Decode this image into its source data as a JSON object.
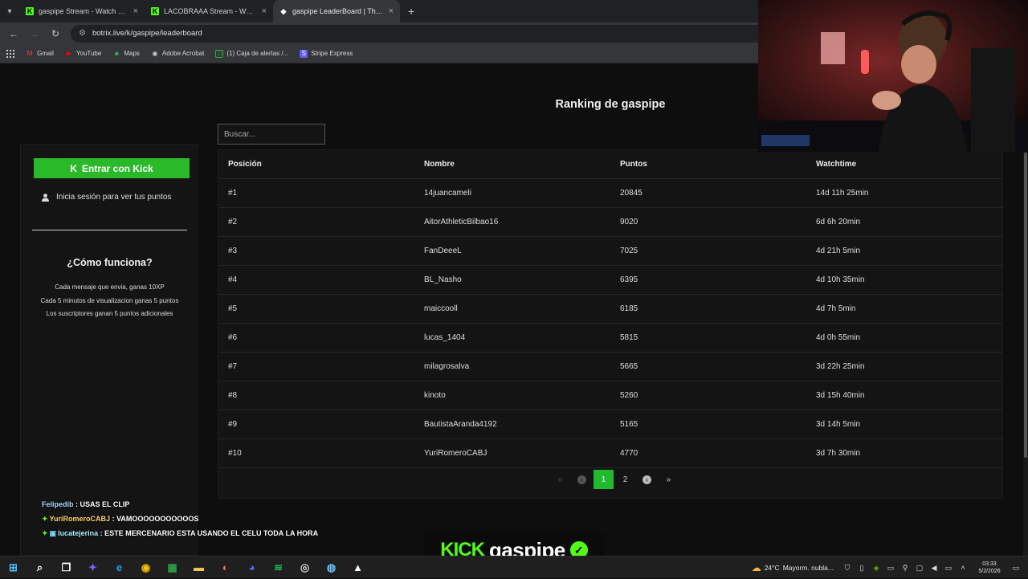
{
  "browser": {
    "tabs": [
      {
        "title": "gaspipe Stream - Watch Live on",
        "icon": "kick-icon"
      },
      {
        "title": "LACOBRAAA Stream - Watch Li",
        "icon": "kick-icon"
      },
      {
        "title": "gaspipe LeaderBoard | The best",
        "icon": "botrix-icon",
        "active": true
      }
    ],
    "url": "botrix.live/k/gaspipe/leaderboard",
    "bookmarks": [
      {
        "label": "Gmail",
        "icon": "gmail-icon",
        "color": "#ea4335"
      },
      {
        "label": "YouTube",
        "icon": "youtube-icon",
        "color": "#ff0000"
      },
      {
        "label": "Maps",
        "icon": "maps-icon",
        "color": "#34a853"
      },
      {
        "label": "Adobe Acrobat",
        "icon": "acrobat-icon",
        "color": "#cccccc"
      },
      {
        "label": "(1) Caja de alertas /...",
        "icon": "alerts-icon",
        "color": "#2fb52f"
      },
      {
        "label": "Stripe Express",
        "icon": "stripe-icon",
        "color": "#635bff"
      }
    ]
  },
  "page": {
    "title": "Ranking de gaspipe",
    "search_placeholder": "Buscar...",
    "sidebar": {
      "kick_button": "Entrar con Kick",
      "login_text": "Inicia sesión para ver tus puntos",
      "how_title": "¿Cómo funciona?",
      "rules": [
        "Cada mensaje que envia, ganas 10XP",
        "Cada 5 minutos de visualizacion ganas 5 puntos",
        "Los suscriptores ganan 5 puntos adicionales"
      ]
    },
    "table": {
      "headers": [
        "Posición",
        "Nombre",
        "Puntos",
        "Watchtime"
      ],
      "rows": [
        [
          "#1",
          "14juancameli",
          "20845",
          "14d 11h 25min"
        ],
        [
          "#2",
          "AitorAthleticBilbao16",
          "9020",
          "6d 6h 20min"
        ],
        [
          "#3",
          "FanDeeeL",
          "7025",
          "4d 21h 5min"
        ],
        [
          "#4",
          "BL_Nasho",
          "6395",
          "4d 10h 35min"
        ],
        [
          "#5",
          "maiccooll",
          "6185",
          "4d 7h 5min"
        ],
        [
          "#6",
          "lucas_1404",
          "5815",
          "4d 0h 55min"
        ],
        [
          "#7",
          "milagrosalva",
          "5665",
          "3d 22h 25min"
        ],
        [
          "#8",
          "kinoto",
          "5260",
          "3d 15h 40min"
        ],
        [
          "#9",
          "BautistaAranda4192",
          "5165",
          "3d 14h 5min"
        ],
        [
          "#10",
          "YuriRomeroCABJ",
          "4770",
          "3d 7h 30min"
        ]
      ]
    },
    "pagination": {
      "pages": [
        "1",
        "2"
      ],
      "current": "1"
    }
  },
  "overlay": {
    "chat": [
      {
        "user": "Felipedib",
        "message": ": USAS EL CLIP",
        "badge": false
      },
      {
        "user": "YuriRomeroCABJ",
        "message": ": VAMOOOOOOOOOOOS",
        "badge": true
      },
      {
        "user": "lucatejerina",
        "message": ": ESTE MERCENARIO ESTA USANDO EL CELU TODA LA HORA",
        "badge": true
      }
    ],
    "brand_logo": "KICK",
    "brand_name": "gaspipe"
  },
  "taskbar": {
    "apps": [
      {
        "icon": "windows-start-icon",
        "color": "#4cc2ff"
      },
      {
        "icon": "search-icon",
        "color": "#ffffff"
      },
      {
        "icon": "task-view-icon",
        "color": "#ffffff"
      },
      {
        "icon": "copilot-icon",
        "color": "#7b61ff"
      },
      {
        "icon": "edge-icon",
        "color": "#1da1f2"
      },
      {
        "icon": "chrome-icon",
        "color": "#fbbc05"
      },
      {
        "icon": "store-icon",
        "color": "#2ea043"
      },
      {
        "icon": "file-explorer-icon",
        "color": "#f4c84a"
      },
      {
        "icon": "firefox-icon",
        "color": "#ff7139"
      },
      {
        "icon": "discord-icon",
        "color": "#5865f2"
      },
      {
        "icon": "spotify-icon",
        "color": "#1db954"
      },
      {
        "icon": "obs-icon",
        "color": "#cccccc"
      },
      {
        "icon": "steam-icon",
        "color": "#66c0f4"
      },
      {
        "icon": "game-app-icon",
        "color": "#ffffff"
      }
    ],
    "weather": {
      "temp": "24°C",
      "desc": "Mayorm. nubla..."
    },
    "clock": {
      "time": "03:33",
      "date": "5/2/2026"
    }
  },
  "colors": {
    "accent": "#1fbb2d",
    "kick_green": "#53fc18",
    "background": "#0e0e0e",
    "panel": "#141414"
  }
}
